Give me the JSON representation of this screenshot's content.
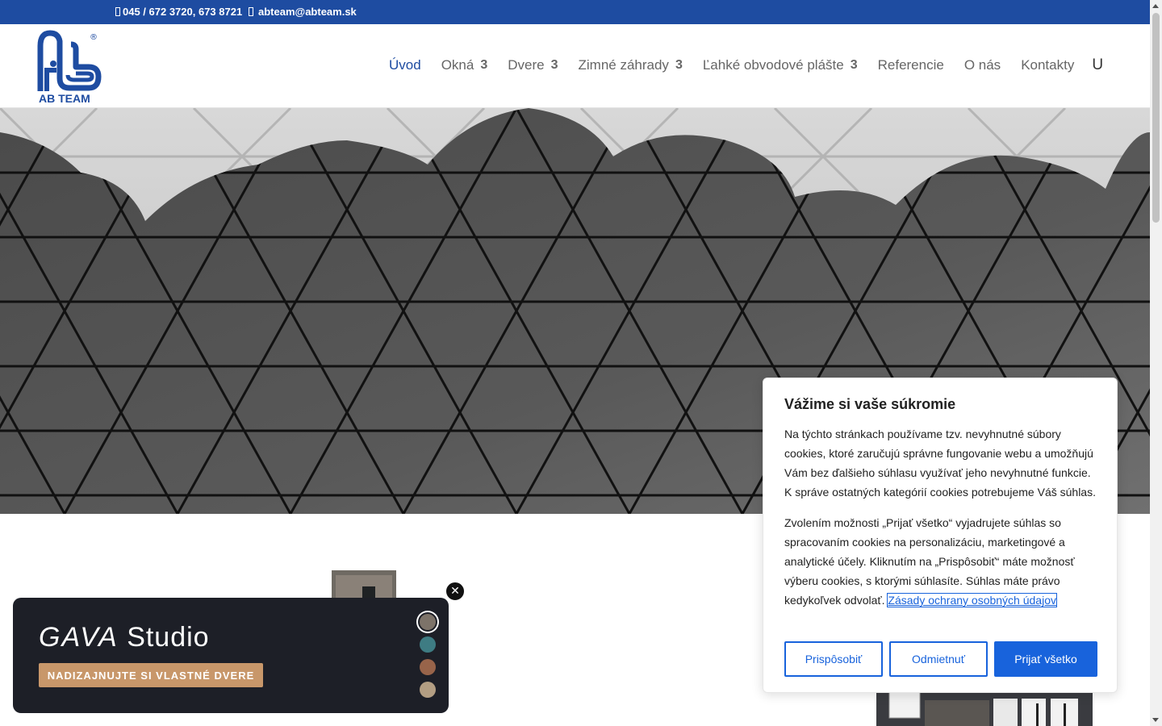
{
  "topbar": {
    "phone": "045 / 672 3720, 673 8721",
    "email": "abteam@abteam.sk",
    "phone_icon": "phone-icon",
    "email_icon": "envelope-icon",
    "bg_color": "#1e4ca1"
  },
  "logo": {
    "text": "AB TEAM",
    "registered": "®",
    "color": "#1e4ca1"
  },
  "nav": {
    "items": [
      {
        "label": "Úvod",
        "has_submenu": false,
        "active": true
      },
      {
        "label": "Okná",
        "has_submenu": true,
        "chevron": "3"
      },
      {
        "label": "Dvere",
        "has_submenu": true,
        "chevron": "3"
      },
      {
        "label": "Zimné záhrady",
        "has_submenu": true,
        "chevron": "3"
      },
      {
        "label": "Ľahké obvodové plášte",
        "has_submenu": true,
        "chevron": "3"
      },
      {
        "label": "Referencie",
        "has_submenu": false
      },
      {
        "label": "O nás",
        "has_submenu": false
      },
      {
        "label": "Kontakty",
        "has_submenu": false
      }
    ],
    "search_glyph": "U",
    "active_color": "#1e4ca1"
  },
  "hero": {
    "image": "geodesic-glass-dome-photo"
  },
  "cookie": {
    "title": "Vážime si vaše súkromie",
    "paragraph1": "Na týchto stránkach používame tzv. nevyhnutné súbory cookies, ktoré zaručujú správne fungovanie webu a umožňujú Vám bez ďalšieho súhlasu využívať jeho nevyhnutné funkcie. K správe ostatných kategórií cookies potrebujeme Váš súhlas.",
    "paragraph2": "Zvolením možnosti „Prijať všetko“ vyjadrujete súhlas so spracovaním cookies na personalizáciu, marketingové a analytické účely. Kliknutím na „Prispôsobiť“ máte možnosť výberu cookies, s ktorými súhlasíte. Súhlas máte právo kedykoľvek odvolať.",
    "policy_link": "Zásady ochrany osobných údajov",
    "customize": "Prispôsobiť",
    "reject": "Odmietnuť",
    "accept": "Prijať všetko",
    "accent_color": "#1863dc"
  },
  "gava": {
    "brand_logo": "GAVA",
    "brand_studio": "Studio",
    "cta": "NADIZAJNUJTE SI VLASTNÉ DVERE",
    "close_icon": "close-icon",
    "swatches": [
      "#7d7369",
      "#3e7c83",
      "#98644a",
      "#b39e83"
    ],
    "selected_swatch": 0
  }
}
